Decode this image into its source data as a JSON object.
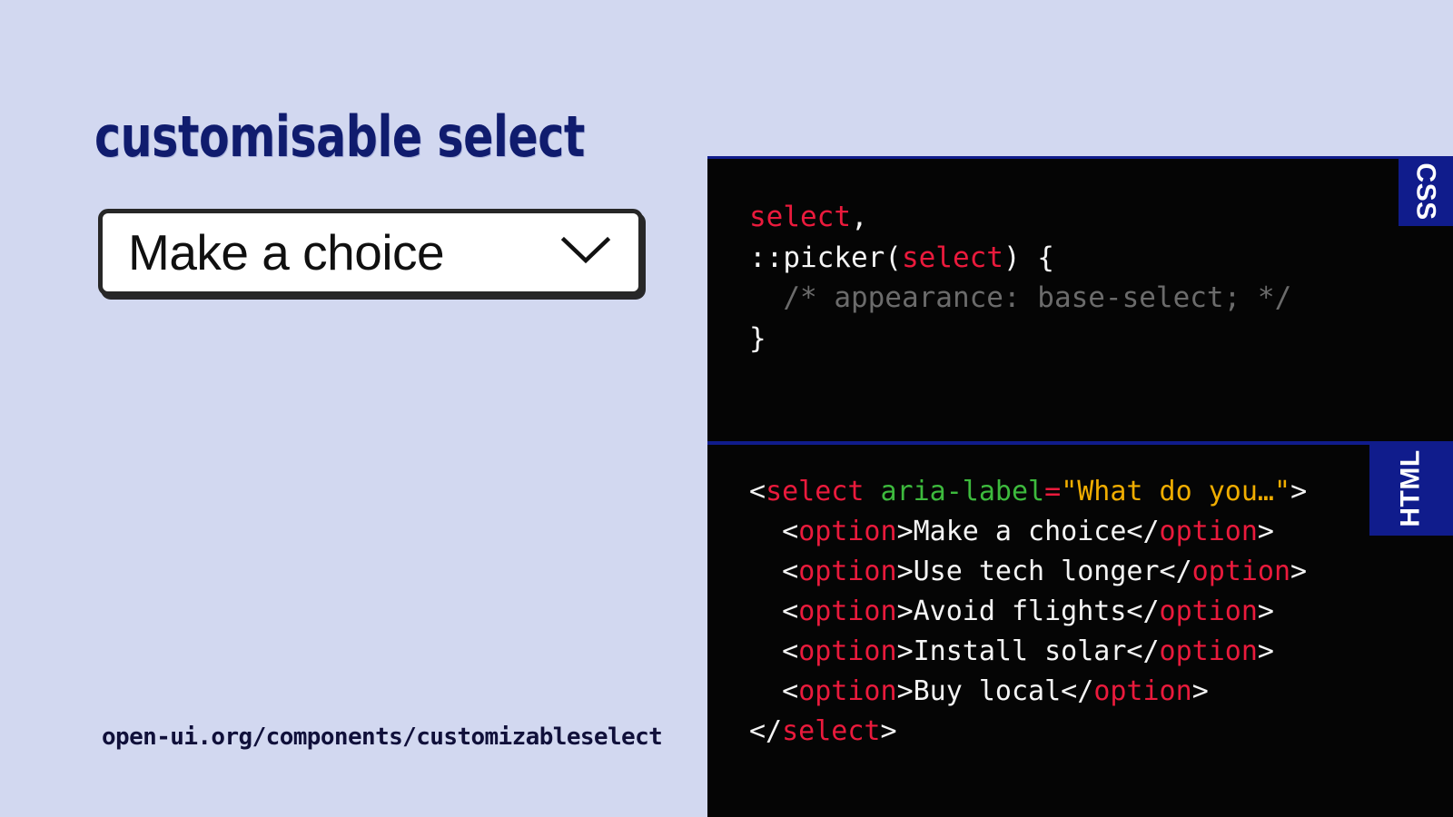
{
  "page": {
    "background_color": "#d2d8f0",
    "title": "customisable select",
    "title_color": "#101c6e"
  },
  "select": {
    "value": "Make a choice",
    "chevron_icon": "chevron-down-icon",
    "border_color": "#272727",
    "background_color": "#ffffff"
  },
  "footer": {
    "url": "open-ui.org/components/customizableselect"
  },
  "code_panel": {
    "background_color": "#050505",
    "divider_color": "#101c8c",
    "css": {
      "badge_label": "CSS",
      "lines": [
        [
          {
            "text": "select",
            "token": "sel"
          },
          {
            "text": ",",
            "token": "punct"
          }
        ],
        [
          {
            "text": "::picker(",
            "token": "punct"
          },
          {
            "text": "select",
            "token": "sel"
          },
          {
            "text": ") {",
            "token": "punct"
          }
        ],
        [
          {
            "text": "  /* appearance: base-select; */",
            "token": "comment"
          }
        ],
        [
          {
            "text": "}",
            "token": "punct"
          }
        ]
      ]
    },
    "html": {
      "badge_label": "HTML",
      "lines": [
        [
          {
            "text": "<",
            "token": "punct"
          },
          {
            "text": "select",
            "token": "tag"
          },
          {
            "text": " ",
            "token": "punct"
          },
          {
            "text": "aria-label",
            "token": "attr"
          },
          {
            "text": "=",
            "token": "eq"
          },
          {
            "text": "\"What do you…\"",
            "token": "val"
          },
          {
            "text": ">",
            "token": "punct"
          }
        ],
        [
          {
            "text": "  <",
            "token": "punct"
          },
          {
            "text": "option",
            "token": "tag"
          },
          {
            "text": ">Make a choice</",
            "token": "text"
          },
          {
            "text": "option",
            "token": "tag"
          },
          {
            "text": ">",
            "token": "punct"
          }
        ],
        [
          {
            "text": "  <",
            "token": "punct"
          },
          {
            "text": "option",
            "token": "tag"
          },
          {
            "text": ">Use tech longer</",
            "token": "text"
          },
          {
            "text": "option",
            "token": "tag"
          },
          {
            "text": ">",
            "token": "punct"
          }
        ],
        [
          {
            "text": "  <",
            "token": "punct"
          },
          {
            "text": "option",
            "token": "tag"
          },
          {
            "text": ">Avoid flights</",
            "token": "text"
          },
          {
            "text": "option",
            "token": "tag"
          },
          {
            "text": ">",
            "token": "punct"
          }
        ],
        [
          {
            "text": "  <",
            "token": "punct"
          },
          {
            "text": "option",
            "token": "tag"
          },
          {
            "text": ">Install solar</",
            "token": "text"
          },
          {
            "text": "option",
            "token": "tag"
          },
          {
            "text": ">",
            "token": "punct"
          }
        ],
        [
          {
            "text": "  <",
            "token": "punct"
          },
          {
            "text": "option",
            "token": "tag"
          },
          {
            "text": ">Buy local</",
            "token": "text"
          },
          {
            "text": "option",
            "token": "tag"
          },
          {
            "text": ">",
            "token": "punct"
          }
        ],
        [
          {
            "text": "</",
            "token": "punct"
          },
          {
            "text": "select",
            "token": "tag"
          },
          {
            "text": ">",
            "token": "punct"
          }
        ]
      ]
    }
  },
  "select_options": [
    "Make a choice",
    "Use tech longer",
    "Avoid flights",
    "Install solar",
    "Buy local"
  ]
}
